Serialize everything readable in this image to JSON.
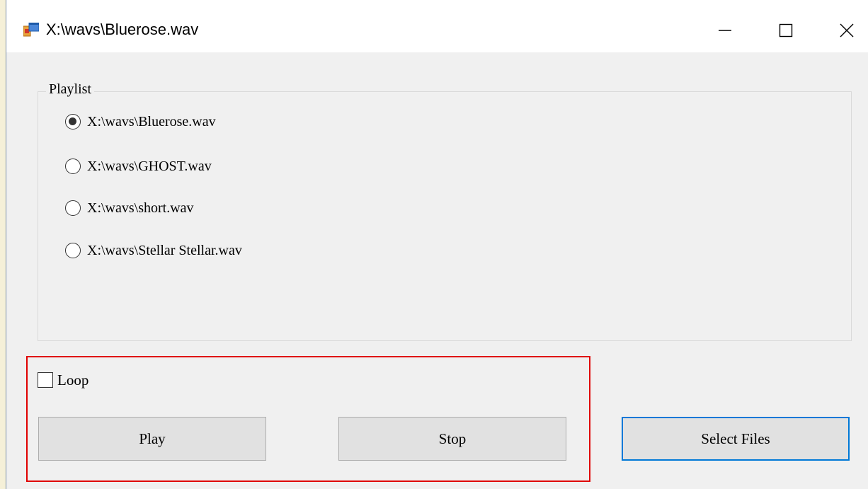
{
  "window": {
    "title": "X:\\wavs\\Bluerose.wav",
    "icon": "windows-form-icon"
  },
  "titlebar_controls": {
    "minimize": "minimize-icon",
    "maximize": "maximize-icon",
    "close": "close-icon"
  },
  "playlist": {
    "label": "Playlist",
    "items": [
      {
        "label": "X:\\wavs\\Bluerose.wav",
        "selected": true
      },
      {
        "label": "X:\\wavs\\GHOST.wav",
        "selected": false
      },
      {
        "label": "X:\\wavs\\short.wav",
        "selected": false
      },
      {
        "label": "X:\\wavs\\Stellar Stellar.wav",
        "selected": false
      }
    ]
  },
  "controls": {
    "loop_label": "Loop",
    "loop_checked": false,
    "play_label": "Play",
    "stop_label": "Stop",
    "select_files_label": "Select Files"
  },
  "colors": {
    "highlight_frame": "#e00000",
    "focused_button_border": "#0078d7"
  }
}
